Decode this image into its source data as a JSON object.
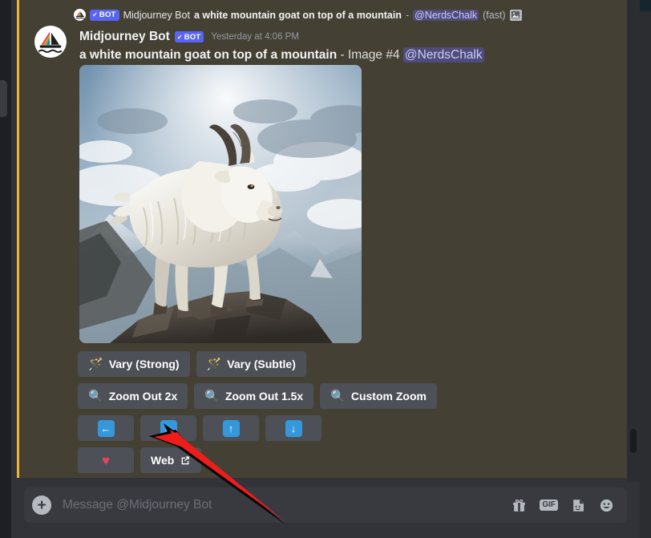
{
  "reply_reference": {
    "bot_tag": "BOT",
    "bot_tag_check": "✓",
    "author": "Midjourney Bot",
    "prompt": "a white mountain goat on top of a mountain",
    "separator": "-",
    "mention": "@NerdsChalk",
    "speed": "(fast)",
    "attachment_icon": "image-attachment-icon",
    "avatar_icon": "midjourney-sailboat-logo"
  },
  "message": {
    "author": "Midjourney Bot",
    "bot_tag": "BOT",
    "bot_tag_check": "✓",
    "timestamp": "Yesterday at 4:06 PM",
    "prompt": "a white mountain goat on top of a mountain",
    "separator": "-",
    "image_label": "Image #4",
    "mention": "@NerdsChalk",
    "avatar_icon": "midjourney-sailboat-logo",
    "attachment_alt": "a white mountain goat standing on a rocky summit with snowy mountains and clouds"
  },
  "action_buttons": {
    "row1": [
      {
        "label": "Vary (Strong)",
        "icon": "magic-wand-icon",
        "glyph": "🪄"
      },
      {
        "label": "Vary (Subtle)",
        "icon": "magic-wand-icon",
        "glyph": "🪄"
      }
    ],
    "row2": [
      {
        "label": "Zoom Out 2x",
        "icon": "magnifier-icon",
        "glyph": "🔍"
      },
      {
        "label": "Zoom Out 1.5x",
        "icon": "magnifier-icon",
        "glyph": "🔍"
      },
      {
        "label": "Custom Zoom",
        "icon": "magnifier-icon",
        "glyph": "🔍"
      }
    ],
    "row3": [
      {
        "label": "",
        "icon": "arrow-left-icon",
        "glyph": "←"
      },
      {
        "label": "",
        "icon": "arrow-right-icon",
        "glyph": "→"
      },
      {
        "label": "",
        "icon": "arrow-up-icon",
        "glyph": "↑"
      },
      {
        "label": "",
        "icon": "arrow-down-icon",
        "glyph": "↓"
      }
    ],
    "row4": [
      {
        "label": "",
        "icon": "heart-icon",
        "glyph": "♥"
      },
      {
        "label": "Web",
        "icon": "external-link-icon",
        "glyph": "↗"
      }
    ]
  },
  "composer": {
    "placeholder": "Message @Midjourney Bot",
    "value": "",
    "add_button": "+",
    "icons": [
      {
        "name": "gift-icon",
        "label": ""
      },
      {
        "name": "gif-icon",
        "label": "GIF"
      },
      {
        "name": "sticker-icon",
        "label": ""
      },
      {
        "name": "emoji-icon",
        "label": ""
      }
    ]
  },
  "colors": {
    "mention_highlight": "#444033",
    "mention_bar": "#f0b232",
    "button_bg": "#4e5058",
    "arrow_blue": "#3498db",
    "bot_tag_blue": "#5865f2",
    "heart_red": "#e0495c",
    "annotation_red": "#ef1c1c",
    "chat_bg": "#313338",
    "composer_bg": "#383a40"
  },
  "annotation": {
    "type": "arrow",
    "points_to": "arrow-right-button",
    "color": "#ef1c1c"
  }
}
